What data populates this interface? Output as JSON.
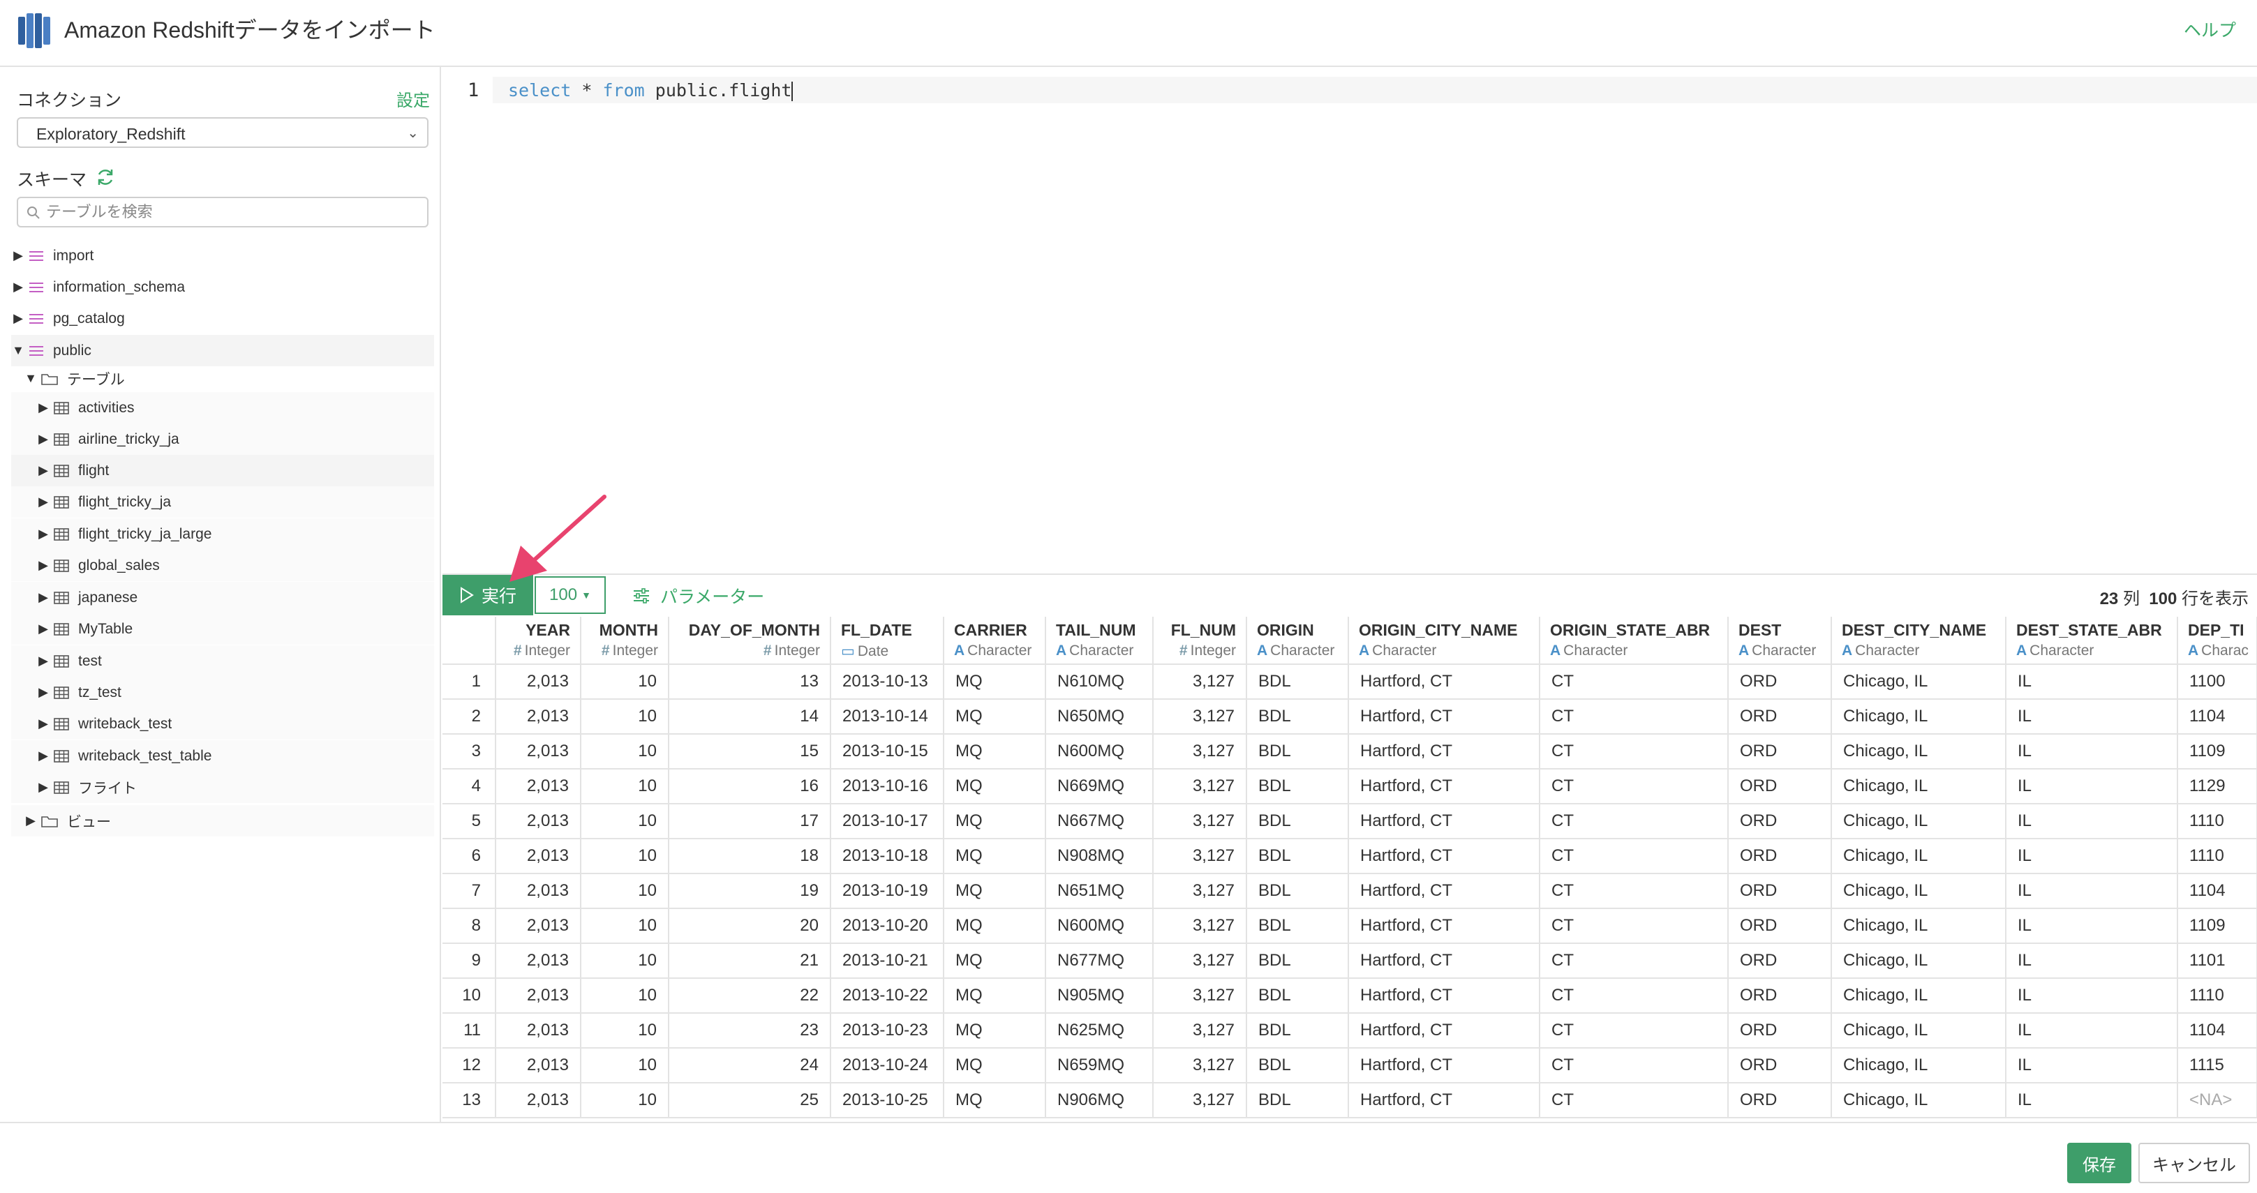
{
  "header": {
    "title": "Amazon Redshiftデータをインポート",
    "help": "ヘルプ"
  },
  "sidebar": {
    "connection_label": "コネクション",
    "settings": "設定",
    "connection_value": "Exploratory_Redshift",
    "schema_label": "スキーマ",
    "search_placeholder": "テーブルを検索",
    "schemas": [
      "import",
      "information_schema",
      "pg_catalog",
      "public"
    ],
    "folder_tables": "テーブル",
    "tables": [
      "activities",
      "airline_tricky_ja",
      "flight",
      "flight_tricky_ja",
      "flight_tricky_ja_large",
      "global_sales",
      "japanese",
      "MyTable",
      "test",
      "tz_test",
      "writeback_test",
      "writeback_test_table",
      "フライト"
    ],
    "folder_views": "ビュー"
  },
  "editor": {
    "line_number": "1",
    "kw_select": "select",
    "op_star": "*",
    "kw_from": "from",
    "table_ref": "public.flight"
  },
  "toolbar": {
    "run": "実行",
    "limit": "100",
    "parameters": "パラメーター",
    "cols_count": "23",
    "cols_unit": "列",
    "rows_count": "100",
    "rows_unit": "行を表示"
  },
  "table": {
    "columns": [
      {
        "name": "YEAR",
        "type": "Integer"
      },
      {
        "name": "MONTH",
        "type": "Integer"
      },
      {
        "name": "DAY_OF_MONTH",
        "type": "Integer"
      },
      {
        "name": "FL_DATE",
        "type": "Date"
      },
      {
        "name": "CARRIER",
        "type": "Character"
      },
      {
        "name": "TAIL_NUM",
        "type": "Character"
      },
      {
        "name": "FL_NUM",
        "type": "Integer"
      },
      {
        "name": "ORIGIN",
        "type": "Character"
      },
      {
        "name": "ORIGIN_CITY_NAME",
        "type": "Character"
      },
      {
        "name": "ORIGIN_STATE_ABR",
        "type": "Character"
      },
      {
        "name": "DEST",
        "type": "Character"
      },
      {
        "name": "DEST_CITY_NAME",
        "type": "Character"
      },
      {
        "name": "DEST_STATE_ABR",
        "type": "Character"
      },
      {
        "name": "DEP_TI",
        "type": "Charac"
      }
    ],
    "rows": [
      [
        "1",
        "2,013",
        "10",
        "13",
        "2013-10-13",
        "MQ",
        "N610MQ",
        "3,127",
        "BDL",
        "Hartford, CT",
        "CT",
        "ORD",
        "Chicago, IL",
        "IL",
        "1100"
      ],
      [
        "2",
        "2,013",
        "10",
        "14",
        "2013-10-14",
        "MQ",
        "N650MQ",
        "3,127",
        "BDL",
        "Hartford, CT",
        "CT",
        "ORD",
        "Chicago, IL",
        "IL",
        "1104"
      ],
      [
        "3",
        "2,013",
        "10",
        "15",
        "2013-10-15",
        "MQ",
        "N600MQ",
        "3,127",
        "BDL",
        "Hartford, CT",
        "CT",
        "ORD",
        "Chicago, IL",
        "IL",
        "1109"
      ],
      [
        "4",
        "2,013",
        "10",
        "16",
        "2013-10-16",
        "MQ",
        "N669MQ",
        "3,127",
        "BDL",
        "Hartford, CT",
        "CT",
        "ORD",
        "Chicago, IL",
        "IL",
        "1129"
      ],
      [
        "5",
        "2,013",
        "10",
        "17",
        "2013-10-17",
        "MQ",
        "N667MQ",
        "3,127",
        "BDL",
        "Hartford, CT",
        "CT",
        "ORD",
        "Chicago, IL",
        "IL",
        "1110"
      ],
      [
        "6",
        "2,013",
        "10",
        "18",
        "2013-10-18",
        "MQ",
        "N908MQ",
        "3,127",
        "BDL",
        "Hartford, CT",
        "CT",
        "ORD",
        "Chicago, IL",
        "IL",
        "1110"
      ],
      [
        "7",
        "2,013",
        "10",
        "19",
        "2013-10-19",
        "MQ",
        "N651MQ",
        "3,127",
        "BDL",
        "Hartford, CT",
        "CT",
        "ORD",
        "Chicago, IL",
        "IL",
        "1104"
      ],
      [
        "8",
        "2,013",
        "10",
        "20",
        "2013-10-20",
        "MQ",
        "N600MQ",
        "3,127",
        "BDL",
        "Hartford, CT",
        "CT",
        "ORD",
        "Chicago, IL",
        "IL",
        "1109"
      ],
      [
        "9",
        "2,013",
        "10",
        "21",
        "2013-10-21",
        "MQ",
        "N677MQ",
        "3,127",
        "BDL",
        "Hartford, CT",
        "CT",
        "ORD",
        "Chicago, IL",
        "IL",
        "1101"
      ],
      [
        "10",
        "2,013",
        "10",
        "22",
        "2013-10-22",
        "MQ",
        "N905MQ",
        "3,127",
        "BDL",
        "Hartford, CT",
        "CT",
        "ORD",
        "Chicago, IL",
        "IL",
        "1110"
      ],
      [
        "11",
        "2,013",
        "10",
        "23",
        "2013-10-23",
        "MQ",
        "N625MQ",
        "3,127",
        "BDL",
        "Hartford, CT",
        "CT",
        "ORD",
        "Chicago, IL",
        "IL",
        "1104"
      ],
      [
        "12",
        "2,013",
        "10",
        "24",
        "2013-10-24",
        "MQ",
        "N659MQ",
        "3,127",
        "BDL",
        "Hartford, CT",
        "CT",
        "ORD",
        "Chicago, IL",
        "IL",
        "1115"
      ],
      [
        "13",
        "2,013",
        "10",
        "25",
        "2013-10-25",
        "MQ",
        "N906MQ",
        "3,127",
        "BDL",
        "Hartford, CT",
        "CT",
        "ORD",
        "Chicago, IL",
        "IL",
        "<NA>"
      ]
    ]
  },
  "footer": {
    "save": "保存",
    "cancel": "キャンセル"
  },
  "colors": {
    "accent": "#3e9e6a",
    "link": "#3aa868",
    "type_icon": "#4a90c8",
    "annotation": "#e8436e",
    "schema_icon": "#c45fc4"
  },
  "icons": [
    "redshift-logo-icon",
    "refresh-icon",
    "search-icon",
    "caret-right-icon",
    "caret-down-icon",
    "schema-icon",
    "folder-icon",
    "table-icon",
    "play-icon",
    "chevron-down-icon",
    "sliders-icon",
    "arrow-annotation-icon"
  ]
}
